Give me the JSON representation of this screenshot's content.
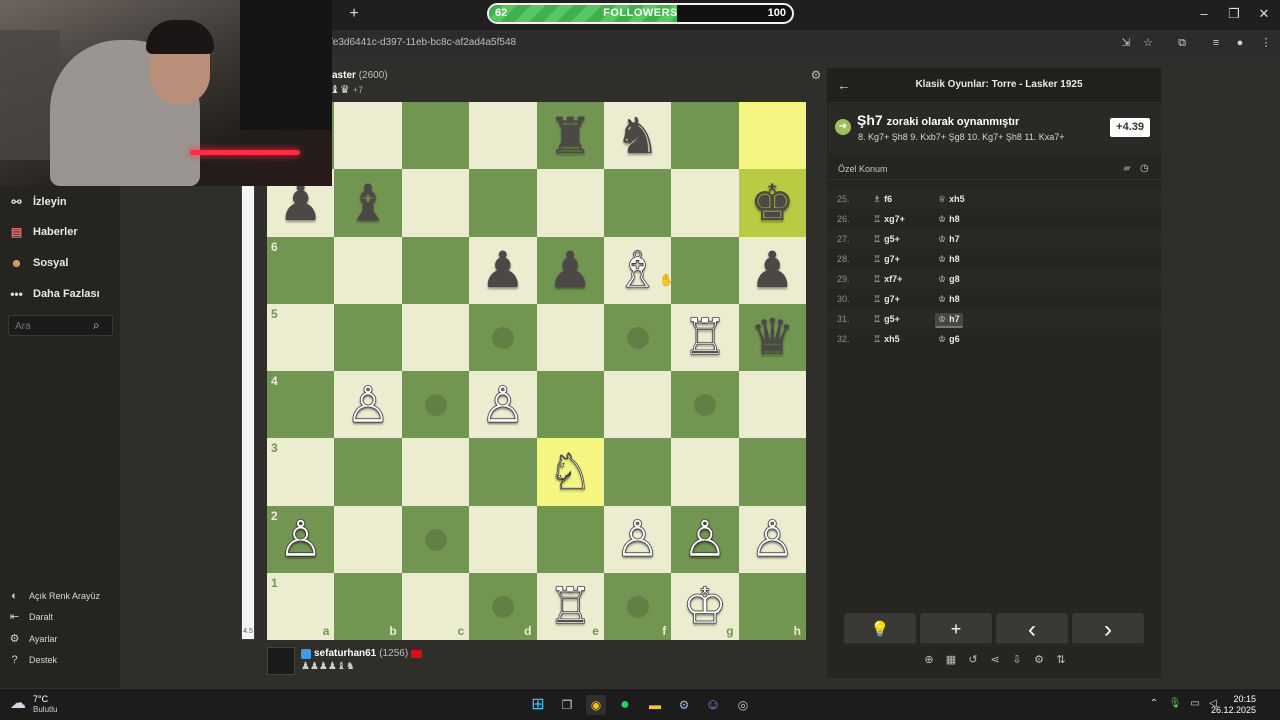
{
  "stream_overlay": {
    "followers_current": "62",
    "followers_label": "FOLLOWERS",
    "followers_goal": "100",
    "progress": 0.62
  },
  "browser": {
    "url": "/e3d6441c-d397-11eb-bc8c-af2ad4a5f548",
    "new_tab": "+"
  },
  "sidebar": {
    "items": [
      {
        "label": "İzleyin",
        "icon": "binoculars-icon"
      },
      {
        "label": "Haberler",
        "icon": "news-icon"
      },
      {
        "label": "Sosyal",
        "icon": "social-icon"
      },
      {
        "label": "Daha Fazlası",
        "icon": "more-icon"
      }
    ],
    "search_placeholder": "Ara",
    "bottom": [
      {
        "label": "Açık Renk Arayüz",
        "icon": "theme-icon"
      },
      {
        "label": "Daralt",
        "icon": "collapse-icon"
      },
      {
        "label": "Ayarlar",
        "icon": "gear-icon"
      },
      {
        "label": "Destek",
        "icon": "help-icon"
      }
    ]
  },
  "opponent": {
    "name": "aster",
    "rating": "(2600)",
    "advantage": "+7"
  },
  "me": {
    "name": "sefaturhan61",
    "rating": "(1256)"
  },
  "eval_bar": {
    "label": "4.5"
  },
  "board": {
    "light": "#ebecd0",
    "dark": "#739552",
    "files": [
      "a",
      "b",
      "c",
      "d",
      "e",
      "f",
      "g",
      "h"
    ],
    "rank_labels": [
      "6",
      "5",
      "4",
      "3",
      "2",
      "1"
    ],
    "pieces": [
      {
        "sq": "e8",
        "p": "♜",
        "c": "b"
      },
      {
        "sq": "f8",
        "p": "♞",
        "c": "b"
      },
      {
        "sq": "a7",
        "p": "♟",
        "c": "b"
      },
      {
        "sq": "b7",
        "p": "♝",
        "c": "b"
      },
      {
        "sq": "h7",
        "p": "♚",
        "c": "b"
      },
      {
        "sq": "d6",
        "p": "♟",
        "c": "b"
      },
      {
        "sq": "e6",
        "p": "♟",
        "c": "b"
      },
      {
        "sq": "f6",
        "p": "♗",
        "c": "w"
      },
      {
        "sq": "h6",
        "p": "♟",
        "c": "b"
      },
      {
        "sq": "g5",
        "p": "♖",
        "c": "w"
      },
      {
        "sq": "h5",
        "p": "♛",
        "c": "b"
      },
      {
        "sq": "b4",
        "p": "♙",
        "c": "w"
      },
      {
        "sq": "d4",
        "p": "♙",
        "c": "w"
      },
      {
        "sq": "e3",
        "p": "♘",
        "c": "w"
      },
      {
        "sq": "a2",
        "p": "♙",
        "c": "w"
      },
      {
        "sq": "f2",
        "p": "♙",
        "c": "w"
      },
      {
        "sq": "g2",
        "p": "♙",
        "c": "w"
      },
      {
        "sq": "h2",
        "p": "♙",
        "c": "w"
      },
      {
        "sq": "e1",
        "p": "♖",
        "c": "w"
      },
      {
        "sq": "g1",
        "p": "♔",
        "c": "w"
      }
    ],
    "highlights": [
      "h8",
      "h7",
      "e3"
    ],
    "dots": [
      "d5",
      "f5",
      "c4",
      "g4",
      "c2",
      "d1",
      "f1"
    ]
  },
  "panel": {
    "title": "Klasik Oyunlar: Torre - Lasker 1925",
    "feedback_move": "Şh7",
    "feedback_text": "zoraki olarak oynanmıştır",
    "feedback_line": "8. Kg7+ Şh8 9. Kxb7+ Şg8 10. Kg7+ Şh8 11. Kxa7+",
    "eval": "+4.39",
    "section": "Özel Konum",
    "moves": [
      {
        "n": "25.",
        "w": "f6",
        "wp": "♗",
        "b": "xh5",
        "bp": "♕"
      },
      {
        "n": "26.",
        "w": "xg7+",
        "wp": "♖",
        "b": "h8",
        "bp": "♔"
      },
      {
        "n": "27.",
        "w": "g5+",
        "wp": "♖",
        "b": "h7",
        "bp": "♔"
      },
      {
        "n": "28.",
        "w": "g7+",
        "wp": "♖",
        "b": "h8",
        "bp": "♔"
      },
      {
        "n": "29.",
        "w": "xf7+",
        "wp": "♖",
        "b": "g8",
        "bp": "♔"
      },
      {
        "n": "30.",
        "w": "g7+",
        "wp": "♖",
        "b": "h8",
        "bp": "♔"
      },
      {
        "n": "31.",
        "w": "g5+",
        "wp": "♖",
        "b": "h7",
        "bp": "♔",
        "active": true
      },
      {
        "n": "32.",
        "w": "xh5",
        "wp": "♖",
        "b": "g6",
        "bp": "♔"
      }
    ],
    "controls": [
      "💡",
      "+",
      "‹",
      "›"
    ]
  },
  "taskbar": {
    "temp": "7°C",
    "weather": "Bulutlu",
    "time": "20:15",
    "date": "26.12.2025"
  }
}
